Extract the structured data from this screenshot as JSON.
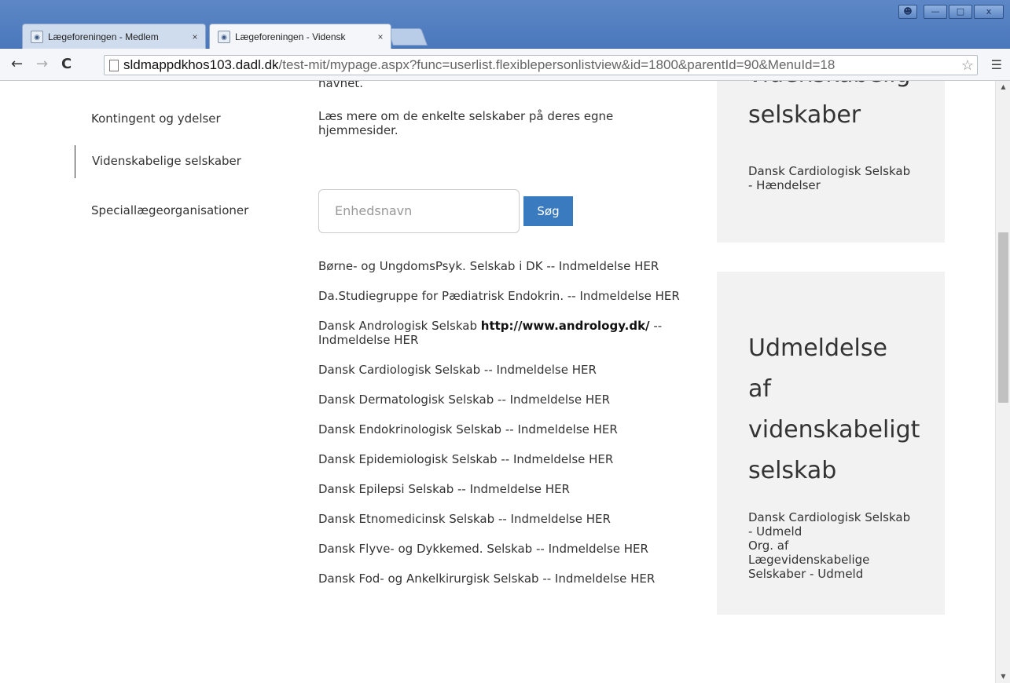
{
  "browser": {
    "tabs": [
      {
        "title": "Lægeforeningen - Medlem",
        "close": "×"
      },
      {
        "title": "Lægeforeningen - Vidensk",
        "close": "×"
      }
    ],
    "url_host": "sldmappdkhos103.dadl.dk",
    "url_path": "/test-mit/mypage.aspx?func=userlist.flexiblepersonlistview&id=1800&parentId=90&MenuId=18"
  },
  "sidebar": {
    "items": [
      {
        "label": "Kontingent og ydelser"
      },
      {
        "label": "Videnskabelige selskaber"
      },
      {
        "label": "Speciallægeorganisationer"
      }
    ]
  },
  "main": {
    "top_fragment": "navnet.",
    "intro": "Læs mere om de enkelte selskaber på deres egne hjemmesider.",
    "search": {
      "placeholder": "Enhedsnavn",
      "button": "Søg"
    },
    "societies": [
      {
        "name": "Børne- og UngdomsPsyk. Selskab i DK",
        "url": "",
        "suffix": "-- Indmeldelse HER"
      },
      {
        "name": "Da.Studiegruppe for Pædiatrisk Endokrin.",
        "url": "",
        "suffix": "-- Indmeldelse HER"
      },
      {
        "name": "Dansk Andrologisk Selskab",
        "url": "http://www.andrology.dk/",
        "suffix": "-- Indmeldelse HER"
      },
      {
        "name": "Dansk Cardiologisk Selskab",
        "url": "",
        "suffix": "-- Indmeldelse HER"
      },
      {
        "name": "Dansk Dermatologisk Selskab",
        "url": "",
        "suffix": "-- Indmeldelse HER"
      },
      {
        "name": "Dansk Endokrinologisk Selskab",
        "url": "",
        "suffix": "-- Indmeldelse HER"
      },
      {
        "name": "Dansk Epidemiologisk Selskab",
        "url": "",
        "suffix": "-- Indmeldelse HER"
      },
      {
        "name": "Dansk Epilepsi Selskab",
        "url": "",
        "suffix": "-- Indmeldelse HER"
      },
      {
        "name": "Dansk Etnomedicinsk Selskab",
        "url": "",
        "suffix": "-- Indmeldelse HER"
      },
      {
        "name": "Dansk Flyve- og Dykkemed. Selskab",
        "url": "",
        "suffix": "-- Indmeldelse HER"
      },
      {
        "name": "Dansk Fod- og Ankelkirurgisk Selskab",
        "url": "",
        "suffix": "-- Indmeldelse HER"
      }
    ]
  },
  "aside": {
    "box1": {
      "heading_cut": "videnskabelige",
      "heading": "selskaber",
      "links": [
        "Dansk Cardiologisk Selskab - Hændelser"
      ]
    },
    "box2": {
      "heading": "Udmeldelse af videnskabeligt selskab",
      "links": [
        "Dansk Cardiologisk Selskab - Udmeld",
        "Org. af Lægevidenskabelige Selskaber - Udmeld"
      ]
    }
  }
}
